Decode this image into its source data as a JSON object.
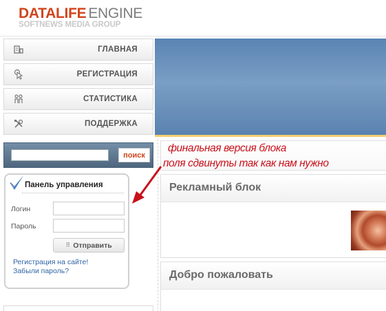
{
  "logo": {
    "brand": "DATALIFE",
    "product": "ENGINE",
    "tagline": "SOFTNEWS MEDIA GROUP"
  },
  "nav": {
    "items": [
      {
        "label": "ГЛАВНАЯ",
        "icon": "home-icon"
      },
      {
        "label": "РЕГИСТРАЦИЯ",
        "icon": "cursor-icon"
      },
      {
        "label": "СТАТИСТИКА",
        "icon": "users-icon"
      },
      {
        "label": "ПОДДЕРЖКА",
        "icon": "tools-icon"
      }
    ]
  },
  "search": {
    "button_label": "поиск",
    "value": ""
  },
  "panel": {
    "title": "Панель управления",
    "login_label": "Логин",
    "password_label": "Пароль",
    "login_value": "",
    "password_value": "",
    "submit_label": "Отправить",
    "register_link": "Регистрация на сайте!",
    "forgot_link": "Забыли пароль?"
  },
  "annotation": {
    "line1": "финальная версия блока",
    "line2": "поля сдвинуты так как нам нужно"
  },
  "content": {
    "ad_title": "Рекламный блок",
    "welcome_title": "Добро пожаловать"
  },
  "colors": {
    "brand_orange": "#d0451b",
    "banner_blue": "#6b93bd",
    "link_blue": "#2e63a6",
    "annotation_red": "#c8101a"
  }
}
